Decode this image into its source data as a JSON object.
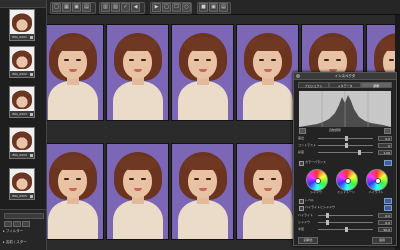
{
  "sidebar": {
    "thumbnails": [
      {
        "caption": "IMG_0001"
      },
      {
        "caption": "IMG_0002"
      },
      {
        "caption": "IMG_0003"
      },
      {
        "caption": "IMG_0004"
      },
      {
        "caption": "IMG_0005"
      }
    ],
    "bottom": {
      "filter_label": "▸ フィルター",
      "footer_label": "▸ 名前 / スター"
    }
  },
  "toolbar": {
    "buttons": [
      "□",
      "▦",
      "▣",
      "▤",
      "▥",
      "▧",
      "✓",
      "◀",
      "▶",
      "▢",
      "☐",
      "○",
      "■",
      "▣",
      "▤"
    ]
  },
  "grid": {
    "rows": 2,
    "cols": 6,
    "selected_index": 10
  },
  "panel": {
    "title": "インスペクタ",
    "tabs": [
      "プロジェクト",
      "メタデータ",
      "調整"
    ],
    "active_tab": 2,
    "histogram_under_label": "自動調整",
    "rows_top": [
      {
        "label": "露出",
        "value": "0.0"
      },
      {
        "label": "コントラスト",
        "value": "0"
      },
      {
        "label": "彩度",
        "value": "1.00"
      }
    ],
    "section_label": "カラーバランス",
    "wheels": [
      "シャドウ",
      "ミッドトーン",
      "ハイライト"
    ],
    "checks": [
      {
        "label": "レベル"
      },
      {
        "label": "ハイライトとシャドウ"
      }
    ],
    "rows_bottom": [
      {
        "label": "ハイライト",
        "value": "0.0"
      },
      {
        "label": "シャドウ",
        "value": "0.0"
      },
      {
        "label": "半径",
        "value": "50.0"
      }
    ],
    "footer": [
      "初期化",
      "適用"
    ]
  },
  "colors": {
    "background": "#2a2a2a",
    "photo_backdrop": "#7b67b5",
    "accent": "#3d5f9a"
  }
}
